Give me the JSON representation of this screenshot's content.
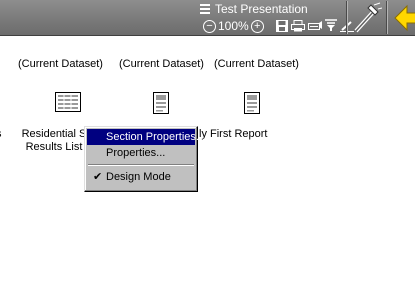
{
  "toolbar": {
    "title": "Test Presentation",
    "zoom_level": "100%",
    "zoom_out_symbol": "−",
    "zoom_in_symbol": "+",
    "icons": [
      "save-icon",
      "print-icon",
      "preview-icon",
      "filter-icon",
      "edit-icon",
      "design-wand-icon",
      "back-arrow-icon"
    ]
  },
  "reports": [
    {
      "dataset": "(Current Dataset)",
      "label": "Residential S\nResults List",
      "icon": "list-report-icon"
    },
    {
      "dataset": "(Current Dataset)",
      "label": "",
      "icon": "document-report-icon"
    },
    {
      "dataset": "(Current Dataset)",
      "label": "ly First Report",
      "icon": "document-report-icon"
    }
  ],
  "left_partial_glyph": "s",
  "context_menu": {
    "items": [
      {
        "label": "Section Properties...",
        "selected": true
      },
      {
        "label": "Properties...",
        "selected": false
      },
      {
        "label": "Design Mode",
        "checked": true,
        "check_mark": "✔"
      }
    ]
  },
  "colors": {
    "toolbar": "#7a7a7a",
    "selection": "#000080",
    "menu_bg": "#c0c0c0",
    "back_arrow": "#ffd700"
  }
}
